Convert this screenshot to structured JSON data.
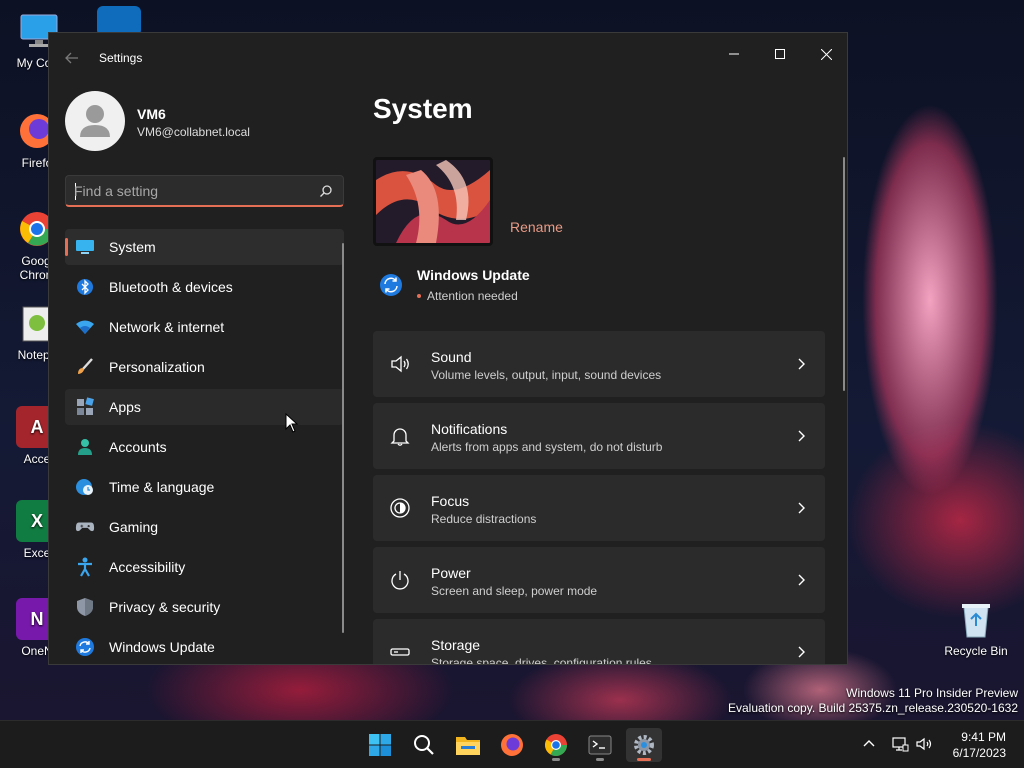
{
  "desktop": {
    "icons": [
      {
        "label": "My Com",
        "glyph": "",
        "color": "#2aa0e8"
      },
      {
        "label": "Firefo",
        "glyph": "",
        "color": "#ff7139"
      },
      {
        "label": "Goog Chron",
        "glyph": "",
        "color": "#34a853"
      },
      {
        "label": "Notepa",
        "glyph": "",
        "color": "#7fbf3f"
      },
      {
        "label": "Acce",
        "glyph": "A",
        "color": "#a4262c"
      },
      {
        "label": "Exce",
        "glyph": "X",
        "color": "#107c41"
      },
      {
        "label": "OneN",
        "glyph": "N",
        "color": "#7719aa"
      }
    ],
    "recycle_bin_label": "Recycle Bin",
    "watermark_line1": "Windows 11 Pro Insider Preview",
    "watermark_line2": "Evaluation copy. Build 25375.zn_release.230520-1632"
  },
  "window": {
    "title": "Settings"
  },
  "profile": {
    "name": "VM6",
    "email": "VM6@collabnet.local"
  },
  "search": {
    "placeholder": "Find a setting"
  },
  "nav": {
    "items": [
      {
        "label": "System",
        "icon": "system-icon"
      },
      {
        "label": "Bluetooth & devices",
        "icon": "bluetooth-icon"
      },
      {
        "label": "Network & internet",
        "icon": "wifi-icon"
      },
      {
        "label": "Personalization",
        "icon": "brush-icon"
      },
      {
        "label": "Apps",
        "icon": "apps-icon"
      },
      {
        "label": "Accounts",
        "icon": "accounts-icon"
      },
      {
        "label": "Time & language",
        "icon": "globe-clock-icon"
      },
      {
        "label": "Gaming",
        "icon": "gamepad-icon"
      },
      {
        "label": "Accessibility",
        "icon": "accessibility-icon"
      },
      {
        "label": "Privacy & security",
        "icon": "shield-icon"
      },
      {
        "label": "Windows Update",
        "icon": "update-icon"
      }
    ]
  },
  "main": {
    "title": "System",
    "rename_label": "Rename",
    "windows_update": {
      "title": "Windows Update",
      "status": "Attention needed"
    },
    "cards": [
      {
        "title": "Sound",
        "subtitle": "Volume levels, output, input, sound devices",
        "icon": "speaker-icon"
      },
      {
        "title": "Notifications",
        "subtitle": "Alerts from apps and system, do not disturb",
        "icon": "bell-icon"
      },
      {
        "title": "Focus",
        "subtitle": "Reduce distractions",
        "icon": "focus-icon"
      },
      {
        "title": "Power",
        "subtitle": "Screen and sleep, power mode",
        "icon": "power-icon"
      },
      {
        "title": "Storage",
        "subtitle": "Storage space, drives, configuration rules",
        "icon": "storage-icon"
      }
    ]
  },
  "taskbar": {
    "time": "9:41 PM",
    "date": "6/17/2023",
    "accent": "#e56f55"
  }
}
